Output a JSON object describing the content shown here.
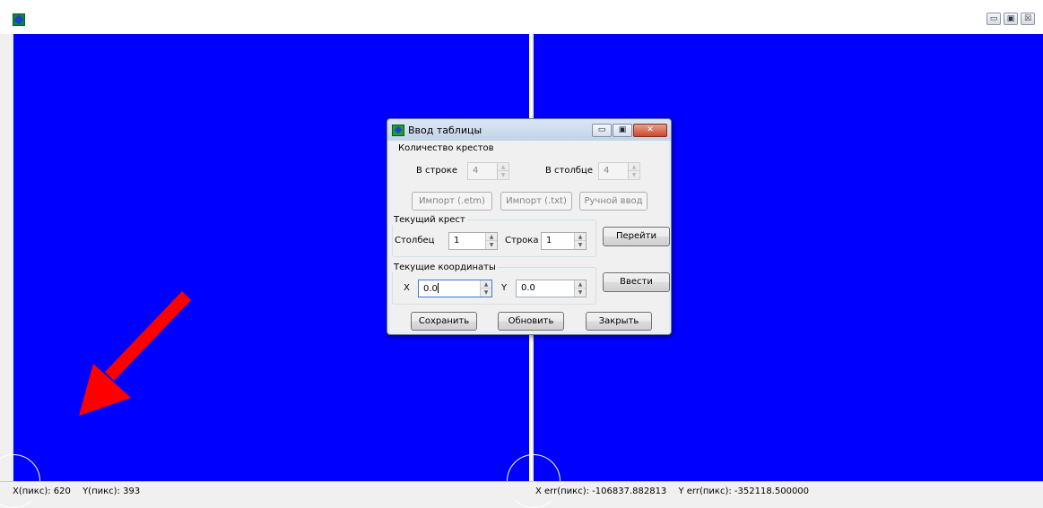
{
  "window": {
    "title": "",
    "controls": {
      "minimize": "▭",
      "maximize": "▣",
      "close": "☒"
    }
  },
  "statusbar": {
    "x_pix": "X(пикс): 620",
    "y_pix": "Y(пикс): 393",
    "x_err": "X err(пикс): -106837.882813",
    "y_err": "Y err(пикс): -352118.500000"
  },
  "dialog": {
    "title": "Ввод таблицы",
    "controls": {
      "minimize": "▭",
      "maximize": "▣",
      "close": "✕"
    },
    "cross_count": {
      "group_label": "Количество крестов",
      "row_label": "В строке",
      "row_value": "4",
      "col_label": "В столбце",
      "col_value": "4"
    },
    "buttons": {
      "import_etm": "Импорт (.etm)",
      "import_txt": "Импорт (.txt)",
      "manual": "Ручной ввод",
      "goto": "Перейти",
      "enter": "Ввести",
      "save": "Сохранить",
      "refresh": "Обновить",
      "close": "Закрыть"
    },
    "current_cross": {
      "group_label": "Текущий крест",
      "col_label": "Столбец",
      "col_value": "1",
      "row_label": "Строка",
      "row_value": "1"
    },
    "current_coords": {
      "group_label": "Текущие координаты",
      "x_label": "X",
      "x_value": "0.0",
      "y_label": "Y",
      "y_value": "0.0"
    }
  },
  "colors": {
    "canvas": "#0000ff",
    "arrow": "#ff0000",
    "divider": "#ffffff"
  },
  "icons": {
    "app": "app-icon",
    "arrow": "red-arrow-annotation"
  }
}
